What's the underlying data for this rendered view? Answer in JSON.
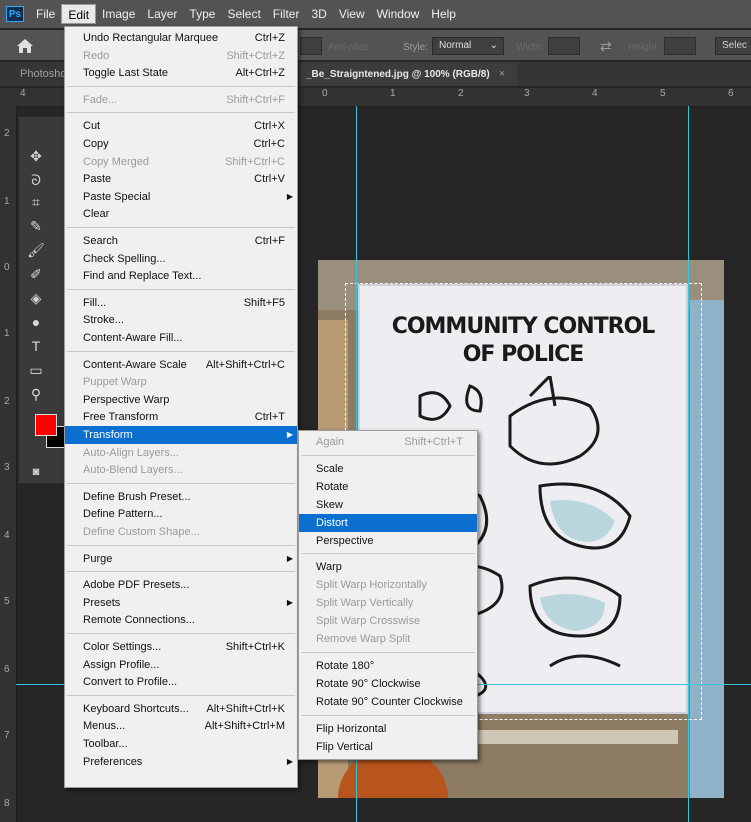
{
  "menubar": {
    "logo": "Ps",
    "items": [
      "File",
      "Edit",
      "Image",
      "Layer",
      "Type",
      "Select",
      "Filter",
      "3D",
      "View",
      "Window",
      "Help"
    ]
  },
  "options": {
    "antialias": "Anti-alias",
    "style_label": "Style:",
    "style_value": "Normal",
    "width_label": "Width:",
    "height_label": "Height:",
    "select_btn": "Selec"
  },
  "tabs": {
    "left": "Photosho",
    "doc": "_Be_Straigntened.jpg @ 100% (RGB/8)",
    "close": "×"
  },
  "ruler": {
    "h": [
      "4",
      "0",
      "1",
      "2",
      "3",
      "4",
      "5",
      "6"
    ],
    "v": [
      "2",
      "1",
      "0",
      "1",
      "2",
      "3",
      "4",
      "5",
      "6",
      "7",
      "8"
    ]
  },
  "sign": {
    "line1": "COMMUNITY CONTROL",
    "line2": "OF POLICE"
  },
  "colors": {
    "foreground": "#ff0000",
    "background": "#000000",
    "highlight": "#0a6fcf",
    "guide": "#35c5dc"
  },
  "edit_menu": [
    {
      "label": "Undo Rectangular Marquee",
      "shortcut": "Ctrl+Z"
    },
    {
      "label": "Redo",
      "shortcut": "Shift+Ctrl+Z",
      "disabled": true
    },
    {
      "label": "Toggle Last State",
      "shortcut": "Alt+Ctrl+Z"
    },
    {
      "sep": true
    },
    {
      "label": "Fade...",
      "shortcut": "Shift+Ctrl+F",
      "disabled": true
    },
    {
      "sep": true
    },
    {
      "label": "Cut",
      "shortcut": "Ctrl+X"
    },
    {
      "label": "Copy",
      "shortcut": "Ctrl+C"
    },
    {
      "label": "Copy Merged",
      "shortcut": "Shift+Ctrl+C",
      "disabled": true
    },
    {
      "label": "Paste",
      "shortcut": "Ctrl+V"
    },
    {
      "label": "Paste Special",
      "shortcut": "",
      "submenu": true
    },
    {
      "label": "Clear",
      "shortcut": ""
    },
    {
      "sep": true
    },
    {
      "label": "Search",
      "shortcut": "Ctrl+F"
    },
    {
      "label": "Check Spelling...",
      "shortcut": ""
    },
    {
      "label": "Find and Replace Text...",
      "shortcut": ""
    },
    {
      "sep": true
    },
    {
      "label": "Fill...",
      "shortcut": "Shift+F5"
    },
    {
      "label": "Stroke...",
      "shortcut": ""
    },
    {
      "label": "Content-Aware Fill...",
      "shortcut": ""
    },
    {
      "sep": true
    },
    {
      "label": "Content-Aware Scale",
      "shortcut": "Alt+Shift+Ctrl+C"
    },
    {
      "label": "Puppet Warp",
      "shortcut": "",
      "disabled": true
    },
    {
      "label": "Perspective Warp",
      "shortcut": ""
    },
    {
      "label": "Free Transform",
      "shortcut": "Ctrl+T"
    },
    {
      "label": "Transform",
      "shortcut": "",
      "submenu": true,
      "highlighted": true
    },
    {
      "label": "Auto-Align Layers...",
      "shortcut": "",
      "disabled": true
    },
    {
      "label": "Auto-Blend Layers...",
      "shortcut": "",
      "disabled": true
    },
    {
      "sep": true
    },
    {
      "label": "Define Brush Preset...",
      "shortcut": ""
    },
    {
      "label": "Define Pattern...",
      "shortcut": ""
    },
    {
      "label": "Define Custom Shape...",
      "shortcut": "",
      "disabled": true
    },
    {
      "sep": true
    },
    {
      "label": "Purge",
      "shortcut": "",
      "submenu": true
    },
    {
      "sep": true
    },
    {
      "label": "Adobe PDF Presets...",
      "shortcut": ""
    },
    {
      "label": "Presets",
      "shortcut": "",
      "submenu": true
    },
    {
      "label": "Remote Connections...",
      "shortcut": ""
    },
    {
      "sep": true
    },
    {
      "label": "Color Settings...",
      "shortcut": "Shift+Ctrl+K"
    },
    {
      "label": "Assign Profile...",
      "shortcut": ""
    },
    {
      "label": "Convert to Profile...",
      "shortcut": ""
    },
    {
      "sep": true
    },
    {
      "label": "Keyboard Shortcuts...",
      "shortcut": "Alt+Shift+Ctrl+K"
    },
    {
      "label": "Menus...",
      "shortcut": "Alt+Shift+Ctrl+M"
    },
    {
      "label": "Toolbar...",
      "shortcut": ""
    },
    {
      "label": "Preferences",
      "shortcut": "",
      "submenu": true
    }
  ],
  "transform_menu": [
    {
      "label": "Again",
      "shortcut": "Shift+Ctrl+T",
      "disabled": true
    },
    {
      "sep": true
    },
    {
      "label": "Scale",
      "shortcut": ""
    },
    {
      "label": "Rotate",
      "shortcut": ""
    },
    {
      "label": "Skew",
      "shortcut": ""
    },
    {
      "label": "Distort",
      "shortcut": "",
      "highlighted": true
    },
    {
      "label": "Perspective",
      "shortcut": ""
    },
    {
      "sep": true
    },
    {
      "label": "Warp",
      "shortcut": ""
    },
    {
      "label": "Split Warp Horizontally",
      "shortcut": "",
      "disabled": true
    },
    {
      "label": "Split Warp Vertically",
      "shortcut": "",
      "disabled": true
    },
    {
      "label": "Split Warp Crosswise",
      "shortcut": "",
      "disabled": true
    },
    {
      "label": "Remove Warp Split",
      "shortcut": "",
      "disabled": true
    },
    {
      "sep": true
    },
    {
      "label": "Rotate 180°",
      "shortcut": ""
    },
    {
      "label": "Rotate 90° Clockwise",
      "shortcut": ""
    },
    {
      "label": "Rotate 90° Counter Clockwise",
      "shortcut": ""
    },
    {
      "sep": true
    },
    {
      "label": "Flip Horizontal",
      "shortcut": ""
    },
    {
      "label": "Flip Vertical",
      "shortcut": ""
    }
  ]
}
